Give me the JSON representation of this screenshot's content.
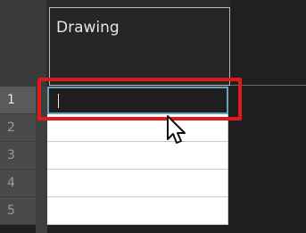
{
  "timeline": {
    "column_header": "Drawing",
    "rows": [
      {
        "number": "1",
        "value": "",
        "editing": true
      },
      {
        "number": "2",
        "value": ""
      },
      {
        "number": "3",
        "value": ""
      },
      {
        "number": "4",
        "value": ""
      },
      {
        "number": "5",
        "value": ""
      }
    ]
  },
  "colors": {
    "highlight": "#e0191b",
    "edit_border": "#6aa3b8"
  },
  "icons": {
    "cursor": "mouse-pointer-icon"
  }
}
